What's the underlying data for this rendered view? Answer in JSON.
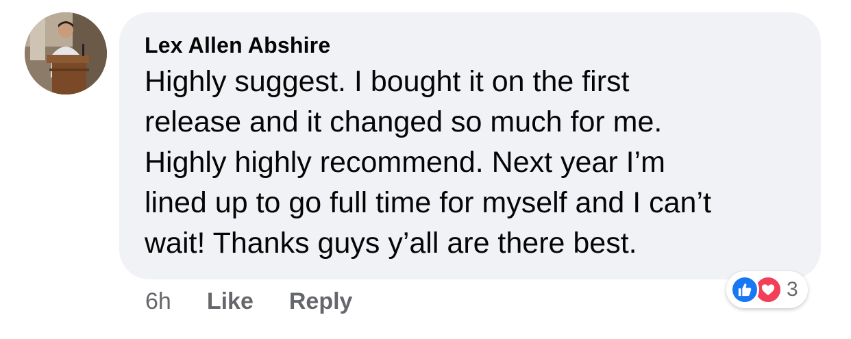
{
  "comment": {
    "author": "Lex Allen Abshire",
    "text": "Highly suggest. I bought it on the first\nrelease and it changed so much for me.\nHighly highly recommend. Next year I’m\nlined up to go full time for myself and I can’t\nwait! Thanks guys y’all are there best.",
    "time": "6h",
    "like_label": "Like",
    "reply_label": "Reply",
    "reactions": {
      "types": [
        "like-icon",
        "heart-icon"
      ],
      "count": "3"
    }
  },
  "colors": {
    "bubble_bg": "#f0f2f5",
    "secondary_text": "#65676b",
    "like_blue": "#1877f2",
    "love_red": "#f33e58"
  }
}
